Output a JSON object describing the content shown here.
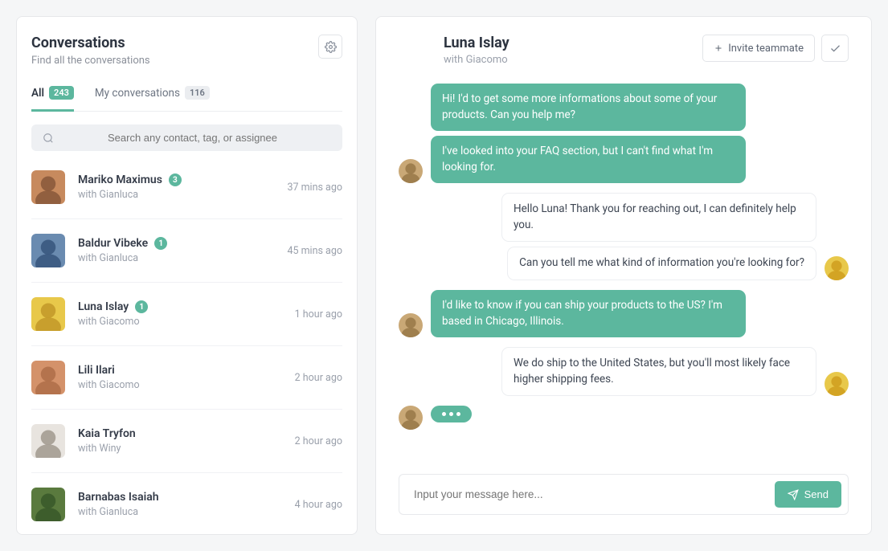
{
  "colors": {
    "accent": "#5cb79e"
  },
  "sidebar": {
    "title": "Conversations",
    "subtitle": "Find all the conversations",
    "tabs": [
      {
        "label": "All",
        "count": "243"
      },
      {
        "label": "My conversations",
        "count": "116"
      }
    ],
    "search_placeholder": "Search any contact, tag, or assignee",
    "items": [
      {
        "name": "Mariko Maximus",
        "with_label": "with Gianluca",
        "time": "37 mins ago",
        "unread": "3",
        "avatar": "#c78a5e|#8b5a3c"
      },
      {
        "name": "Baldur Vibeke",
        "with_label": "with Gianluca",
        "time": "45 mins ago",
        "unread": "1",
        "avatar": "#6a8bb0|#3a5880"
      },
      {
        "name": "Luna Islay",
        "with_label": "with Giacomo",
        "time": "1 hour ago",
        "unread": "1",
        "avatar": "#e8c84a|#c49a2a"
      },
      {
        "name": "Lili Ilari",
        "with_label": "with Giacomo",
        "time": "2 hour ago",
        "unread": "",
        "avatar": "#d4926a|#b0704a"
      },
      {
        "name": "Kaia Tryfon",
        "with_label": "with Winy",
        "time": "2 hour ago",
        "unread": "",
        "avatar": "#e8e4df|#a49c92"
      },
      {
        "name": "Barnabas Isaiah",
        "with_label": "with Gianluca",
        "time": "4 hour ago",
        "unread": "",
        "avatar": "#5a7a3e|#3a5a2a"
      }
    ]
  },
  "chat": {
    "title": "Luna Islay",
    "subtitle": "with Giacomo",
    "invite_label": "Invite teammate",
    "participant_avatar": "#c9a876|#9a7a4a",
    "agent_avatar": "#e8c84a|#d0a020",
    "groups": [
      {
        "side": "them",
        "show_avatar": true,
        "bubbles": [
          "Hi! I'd to get some more informations about some of your products. Can you help me?",
          "I've looked into your FAQ section, but I can't find what I'm looking for."
        ]
      },
      {
        "side": "me",
        "show_avatar": true,
        "bubbles": [
          "Hello Luna! Thank you for reaching out, I can definitely help you.",
          "Can you tell me what kind of information you're looking for?"
        ]
      },
      {
        "side": "them",
        "show_avatar": true,
        "bubbles": [
          "I'd like to know if you can ship your products to the US? I'm based in Chicago, Illinois."
        ]
      },
      {
        "side": "me",
        "show_avatar": true,
        "bubbles": [
          "We do ship to the United States, but you'll most likely face higher shipping fees."
        ]
      },
      {
        "side": "them",
        "show_avatar": true,
        "typing": true,
        "bubbles": []
      }
    ],
    "compose_placeholder": "Input your message here...",
    "send_label": "Send"
  }
}
